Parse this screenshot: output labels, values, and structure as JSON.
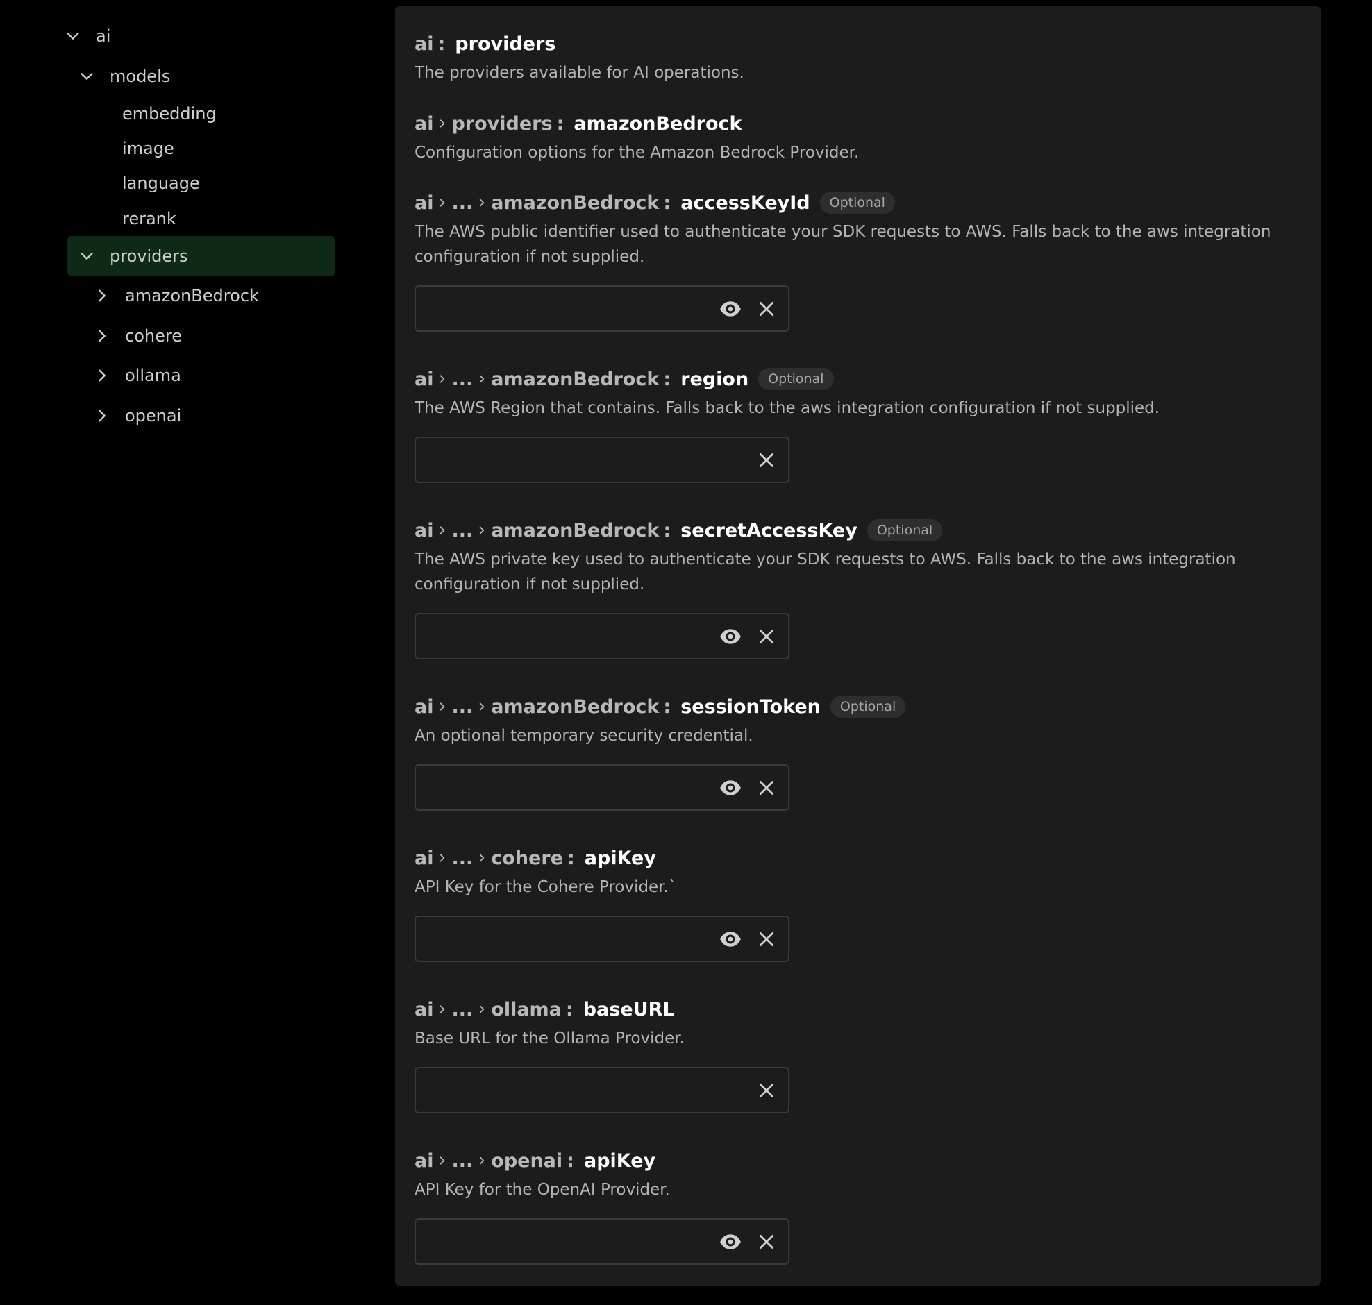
{
  "sidebar": {
    "ai": "ai",
    "models": "models",
    "embedding": "embedding",
    "image": "image",
    "language": "language",
    "rerank": "rerank",
    "providers": "providers",
    "amazonBedrock": "amazonBedrock",
    "cohere": "cohere",
    "ollama": "ollama",
    "openai": "openai"
  },
  "main": {
    "sections": [
      {
        "crumbs": [
          "ai"
        ],
        "key": "providers",
        "description": "The providers available for AI operations."
      },
      {
        "crumbs": [
          "ai",
          "providers"
        ],
        "key": "amazonBedrock",
        "description": "Configuration options for the Amazon Bedrock Provider."
      },
      {
        "crumbs": [
          "ai",
          "...",
          "amazonBedrock"
        ],
        "key": "accessKeyId",
        "badge": "Optional",
        "description": "The AWS public identifier used to authenticate your SDK requests to AWS. Falls back to the aws integration configuration if not supplied.",
        "value": ""
      },
      {
        "crumbs": [
          "ai",
          "...",
          "amazonBedrock"
        ],
        "key": "region",
        "badge": "Optional",
        "description": "The AWS Region that contains. Falls back to the aws integration configuration if not supplied.",
        "value": ""
      },
      {
        "crumbs": [
          "ai",
          "...",
          "amazonBedrock"
        ],
        "key": "secretAccessKey",
        "badge": "Optional",
        "description": "The AWS private key used to authenticate your SDK requests to AWS. Falls back to the aws integration configuration if not supplied.",
        "value": ""
      },
      {
        "crumbs": [
          "ai",
          "...",
          "amazonBedrock"
        ],
        "key": "sessionToken",
        "badge": "Optional",
        "description": "An optional temporary security credential.",
        "value": ""
      },
      {
        "crumbs": [
          "ai",
          "...",
          "cohere"
        ],
        "key": "apiKey",
        "description": "API Key for the Cohere Provider.`",
        "value": ""
      },
      {
        "crumbs": [
          "ai",
          "...",
          "ollama"
        ],
        "key": "baseURL",
        "description": "Base URL for the Ollama Provider.",
        "value": ""
      },
      {
        "crumbs": [
          "ai",
          "...",
          "openai"
        ],
        "key": "apiKey",
        "description": "API Key for the OpenAI Provider.",
        "value": ""
      }
    ]
  },
  "icons": {
    "expanded": "chevron-down-icon",
    "collapsed": "chevron-right-icon",
    "separator": "chevron-right-icon",
    "reveal": "eye-icon",
    "clear": "close-icon"
  },
  "colors": {
    "background": "#000000",
    "panel": "#1c1c1c",
    "selected_row": "#0e2a17",
    "key_text": "#ffffff",
    "muted_text": "#b4b4b4",
    "badge_bg": "#2e2e2e"
  }
}
